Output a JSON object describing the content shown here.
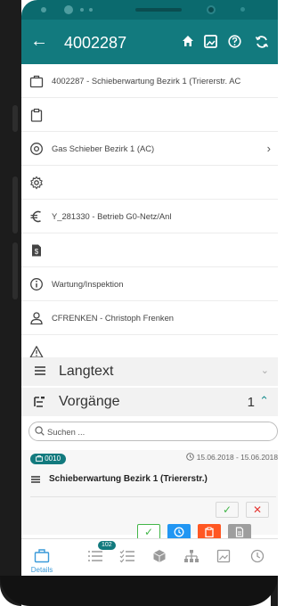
{
  "header": {
    "back_icon": "arrow-left-icon",
    "title": "4002287",
    "actions": [
      "home-icon",
      "image-icon",
      "help-icon",
      "sync-icon"
    ]
  },
  "rows": [
    {
      "icon": "briefcase-icon",
      "text": "4002287 - Schieberwartung Bezirk 1 (Trierer­str. AC",
      "chevron": false
    },
    {
      "icon": "clipboard-icon",
      "text": "",
      "chevron": false
    },
    {
      "icon": "location-icon",
      "text": "Gas Schieber Bezirk 1 (AC)",
      "chevron": true
    },
    {
      "icon": "gear-icon",
      "text": "",
      "chevron": false
    },
    {
      "icon": "euro-icon",
      "text": "Y_281330 - Betrieb G0-Netz/Anl",
      "chevron": false
    },
    {
      "icon": "dollar-doc-icon",
      "text": "",
      "chevron": false
    },
    {
      "icon": "info-icon",
      "text": "Wartung/Inspektion",
      "chevron": false
    },
    {
      "icon": "person-icon",
      "text": "CFRENKEN - Christoph Frenken",
      "chevron": false
    },
    {
      "icon": "warning-icon",
      "text": "",
      "chevron": false
    }
  ],
  "sections": {
    "langtext": {
      "label": "Langtext"
    },
    "vorgaenge": {
      "label": "Vorgänge",
      "count": "1"
    }
  },
  "search": {
    "placeholder": "Suchen ..."
  },
  "task": {
    "badge": "0010",
    "date_range": "15.06.2018 - 15.06.2018",
    "title": "Schieberwartung Bezirk 1 (Triererstr.)"
  },
  "nav": {
    "details_label": "Details",
    "list_badge": "102"
  },
  "colors": {
    "primary": "#127a7e",
    "green": "#43b649",
    "red": "#e53935",
    "blue": "#2196f3",
    "orange": "#ff5722",
    "grey": "#9e9e9e"
  }
}
